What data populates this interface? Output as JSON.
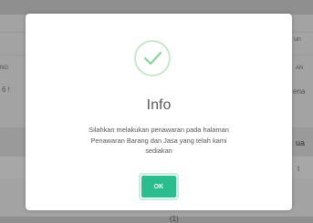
{
  "background": {
    "fragments": [
      {
        "id": "top-right-header",
        "text": "...  ......"
      },
      {
        "id": "right-1",
        "text": "un"
      },
      {
        "id": "left-ng",
        "text": "NG"
      },
      {
        "id": "right-an",
        "text": "AN"
      },
      {
        "id": "left-6",
        "text": "6 !"
      },
      {
        "id": "right-ena",
        "text": "ena"
      },
      {
        "id": "right-ua",
        "text": "ua"
      },
      {
        "id": "right-t",
        "text": "t"
      },
      {
        "id": "bottom-mid",
        "text": "(1)"
      }
    ]
  },
  "modal": {
    "icon": "check-circle-icon",
    "icon_color": "#8fd19e",
    "title": "Info",
    "message_lines": [
      "Silahkan melakukan penawaran pada halaman",
      "Penawaran Barang dan Jasa yang telah kami",
      "sediakan"
    ],
    "ok_label": "OK",
    "ok_color": "#2cbd8e"
  }
}
